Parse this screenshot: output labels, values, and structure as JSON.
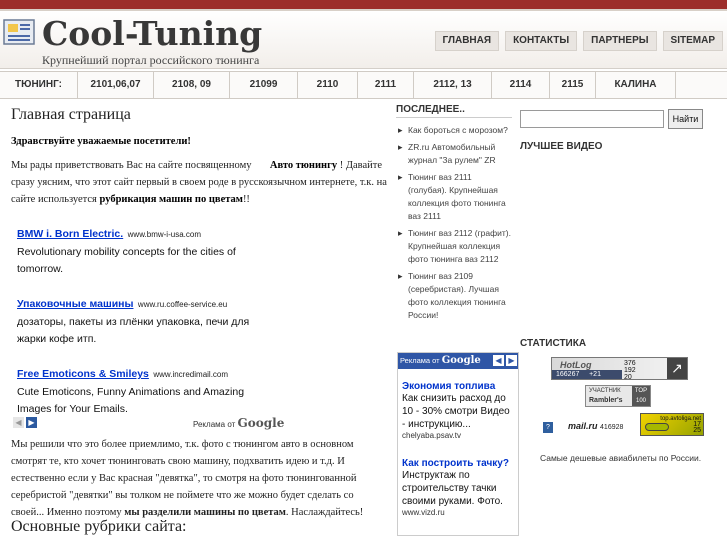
{
  "header": {
    "title": "Cool-Tuning",
    "subtitle": "Крупнейший портал российского тюнинга",
    "nav": [
      "ГЛАВНАЯ",
      "КОНТАКТЫ",
      "ПАРТНЕРЫ",
      "SITEMAP"
    ]
  },
  "tuning_nav": {
    "lead": "ТЮНИНГ:",
    "items": [
      "2101,06,07",
      "2108, 09",
      "21099",
      "2110",
      "2111",
      "2112, 13",
      "2114",
      "2115",
      "КАЛИНА"
    ]
  },
  "main": {
    "title": "Главная страница",
    "welcome": "Здравствуйте уважаемые посетители!",
    "intro_1": "Мы рады приветствовать Вас на сайте посвященному",
    "intro_bold_1": "Авто тюнингу",
    "intro_2": "! Давайте сразу уясним, что этот сайт первый в своем роде в русскоязычном интернете, т.к. на сайте используется",
    "intro_bold_2": "рубрикация машин по цветам",
    "intro_3": "!!",
    "para2_1": "Мы решили что это более приемлимо, т.к. фото с тюнингом авто в основном смотрят те, кто хочет тюнинговать свою машину, подхватить идею и т.д. И естественно если у Вас красная \"девятка\", то смотря на фото тюнингованной серебристой \"девятки\" вы толком не поймете что же можно будет сделать со своей... Именно поэтому",
    "para2_bold": "мы разделили машины по цветам",
    "para2_2": ". Наслаждайтесь!",
    "heading2": "Основные рубрики сайта:"
  },
  "ads": [
    {
      "title": "BMW i. Born Electric.",
      "url": "www.bmw-i-usa.com",
      "text": "Revolutionary mobility concepts for the cities of tomorrow."
    },
    {
      "title": "Упаковочные машины",
      "url": "www.ru.coffee-service.eu",
      "text": "дозаторы, пакеты из плёнки упаковка, печи для жарки кофе итп."
    },
    {
      "title": "Free Emoticons & Smileys",
      "url": "www.incredimail.com",
      "text": "Cute Emoticons, Funny Animations and Amazing Images for Your Emails."
    }
  ],
  "ads_by": {
    "prefix": "Реклама от",
    "brand": "Google"
  },
  "latest": {
    "title": "ПОСЛЕДНЕЕ..",
    "items": [
      "Как бороться с морозом?",
      "ZR.ru Автомобильный журнал \"За рулем\" ZR",
      "Тюнинг ваз 2111 (голубая). Крупнейшая коллекция фото тюнинга ваз 2111",
      "Тюнинг ваз 2112 (графит). Крупнейшая коллекция фото тюнинга ваз 2112",
      "Тюнинг ваз 2109 (серебристая). Лучшая фото коллекция тюнинга России!"
    ]
  },
  "mid_ad": {
    "head_prefix": "Реклама от",
    "head_brand": "Google",
    "items": [
      {
        "title": "Экономия топлива",
        "text": "Как снизить расход до 10 - 30% смотри Видео - инструкцию...",
        "url": "chelyaba.psav.tv"
      },
      {
        "title": "Как построить тачку?",
        "text": "Инструктаж по строительству тачки своими руками. Фото.",
        "url": "www.vizd.ru"
      }
    ]
  },
  "search": {
    "placeholder": "",
    "button": "Найти"
  },
  "best_video": {
    "title": "ЛУЧШЕЕ ВИДЕО"
  },
  "stats": {
    "title": "СТАТИСТИКА",
    "hotlog": {
      "logo": "HotLog",
      "count": "166267",
      "delta": "+21",
      "nums": "376\n192\n20"
    },
    "rambler": {
      "line1": "УЧАСТНИК",
      "line2": "Rambler's",
      "badge": "TOP 100"
    },
    "mail_count": "416928",
    "mail_logo": "mail.ru",
    "toplist": "top.avtoliga.net",
    "toplist_nums": "17\n25"
  },
  "footnote": "Самые дешевые авиабилеты по России."
}
